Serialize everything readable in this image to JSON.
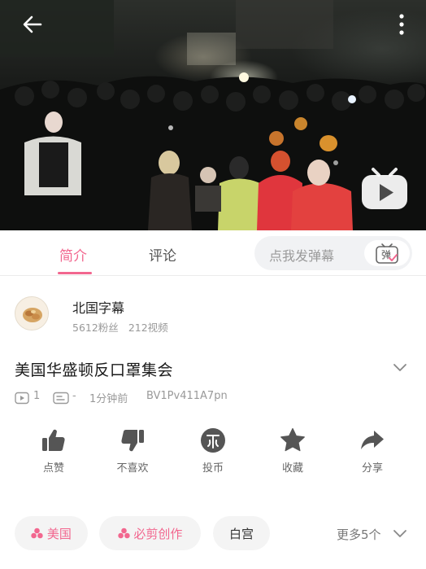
{
  "tabs": {
    "intro": "简介",
    "comments": "评论",
    "danmaku_placeholder": "点我发弹幕",
    "danmaku_icon_label": "弹"
  },
  "uploader": {
    "name": "北国字幕",
    "followers": "5612粉丝",
    "videos": "212视频"
  },
  "video": {
    "title": "美国华盛顿反口罩集会",
    "play_count": "1",
    "danmaku_count": "-",
    "published": "1分钟前",
    "bvid": "BV1Pv411A7pn"
  },
  "actions": [
    {
      "label": "点赞",
      "icon": "thumbs-up-icon"
    },
    {
      "label": "不喜欢",
      "icon": "thumbs-down-icon"
    },
    {
      "label": "投币",
      "icon": "coin-icon"
    },
    {
      "label": "收藏",
      "icon": "star-icon"
    },
    {
      "label": "分享",
      "icon": "share-icon"
    }
  ],
  "tags": [
    {
      "label": "美国",
      "type": "channel"
    },
    {
      "label": "必剪创作",
      "type": "channel"
    },
    {
      "label": "白宫",
      "type": "plain"
    }
  ],
  "more_tags": "更多5个",
  "colors": {
    "accent": "#f2678f",
    "tag_bg": "#f4f4f4",
    "icon_gray": "#555555"
  }
}
